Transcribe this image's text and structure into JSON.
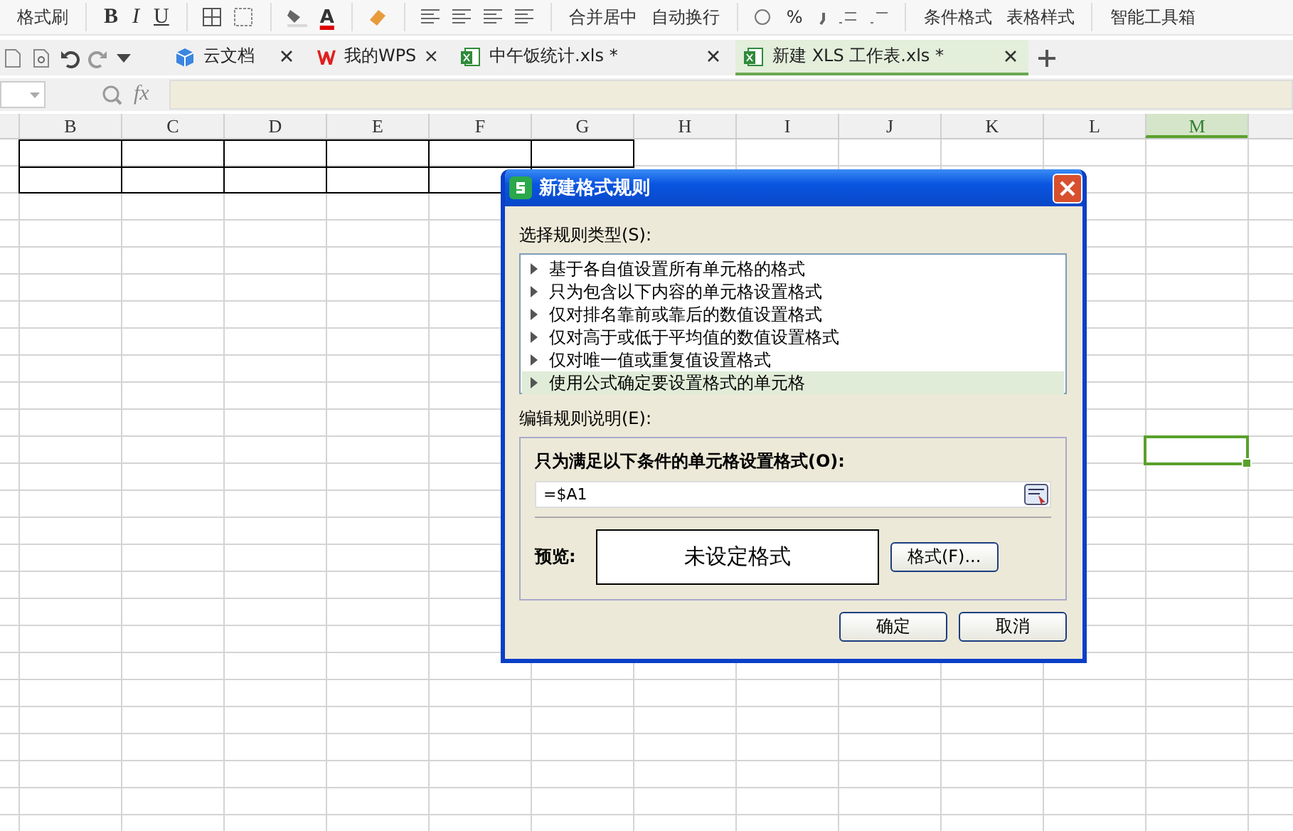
{
  "toolbar": {
    "items": [
      {
        "kind": "text",
        "label": "格式刷"
      },
      {
        "kind": "bold",
        "label": "B"
      },
      {
        "kind": "italic",
        "label": "I"
      },
      {
        "kind": "underline",
        "label": "U"
      },
      {
        "kind": "font-color",
        "label": "A"
      },
      {
        "kind": "dropdown",
        "label": "合并居中"
      },
      {
        "kind": "dropdown",
        "label": "自动换行"
      },
      {
        "kind": "text",
        "label": "%"
      },
      {
        "kind": "dropdown",
        "label": "条件格式"
      },
      {
        "kind": "dropdown",
        "label": "表格样式"
      },
      {
        "kind": "text",
        "label": "智能工具箱"
      }
    ]
  },
  "tabs": [
    {
      "label": "云文档",
      "kind": "cloud",
      "selected": false
    },
    {
      "label": "我的WPS",
      "kind": "wps",
      "selected": false
    },
    {
      "label": "中午饭统计.xls *",
      "kind": "sheet",
      "selected": false
    },
    {
      "label": "新建 XLS 工作表.xls *",
      "kind": "sheet",
      "selected": true
    }
  ],
  "formula_bar": {
    "fx": "fx"
  },
  "columns": [
    {
      "label": "B",
      "selected": false
    },
    {
      "label": "C",
      "selected": false
    },
    {
      "label": "D",
      "selected": false
    },
    {
      "label": "E",
      "selected": false
    },
    {
      "label": "F",
      "selected": false
    },
    {
      "label": "G",
      "selected": false
    },
    {
      "label": "H",
      "selected": false
    },
    {
      "label": "I",
      "selected": false
    },
    {
      "label": "J",
      "selected": false
    },
    {
      "label": "K",
      "selected": false
    },
    {
      "label": "L",
      "selected": false
    },
    {
      "label": "M",
      "selected": true
    }
  ],
  "dialog": {
    "title": "新建格式规则",
    "rule_type_label": "选择规则类型(S):",
    "rules": [
      {
        "label": "基于各自值设置所有单元格的格式",
        "selected": false
      },
      {
        "label": "只为包含以下内容的单元格设置格式",
        "selected": false
      },
      {
        "label": "仅对排名靠前或靠后的数值设置格式",
        "selected": false
      },
      {
        "label": "仅对高于或低于平均值的数值设置格式",
        "selected": false
      },
      {
        "label": "仅对唯一值或重复值设置格式",
        "selected": false
      },
      {
        "label": "使用公式确定要设置格式的单元格",
        "selected": true
      }
    ],
    "edit_label": "编辑规则说明(E):",
    "condition_label": "只为满足以下条件的单元格设置格式(O):",
    "formula": "=$A1",
    "preview_label": "预览:",
    "preview_text": "未设定格式",
    "format_button": "格式(F)...",
    "ok_button": "确定",
    "cancel_button": "取消"
  }
}
